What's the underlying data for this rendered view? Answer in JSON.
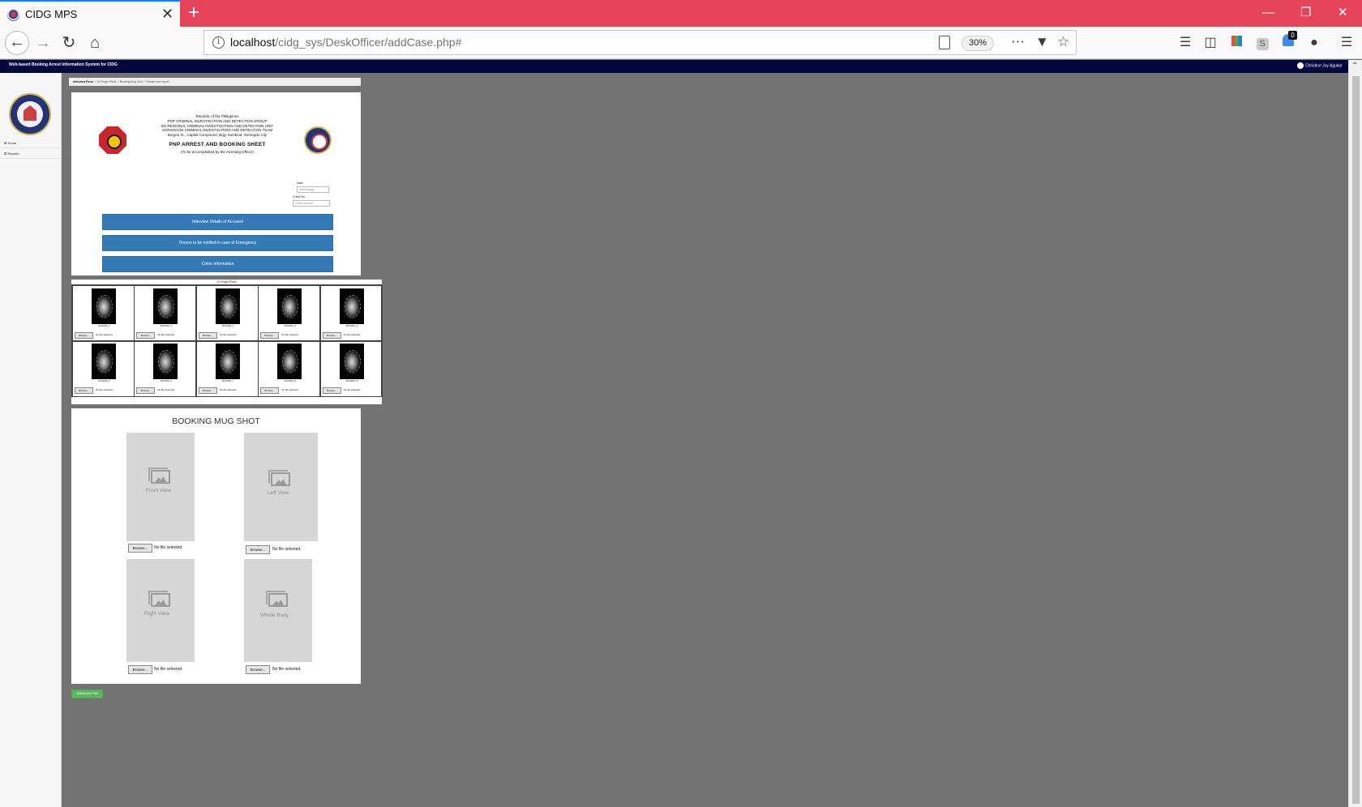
{
  "browser": {
    "tab_title": "CIDG MPS",
    "tab_close": "✕",
    "new_tab": "+",
    "url_host": "localhost",
    "url_path": "/cidg_sys/DeskOfficer/addCase.php#",
    "zoom": "30%",
    "notification_count": "0",
    "accent_color": "#e5445a"
  },
  "site": {
    "title": "Web-based Booking Arrest Information System for CIDG",
    "user": "Christine Joy Aguilar",
    "header_color": "#02063d"
  },
  "sidebar": {
    "items": [
      {
        "label": "⊞ Home"
      },
      {
        "label": "⊞ Reports"
      }
    ]
  },
  "breadcrumb": {
    "items": [
      "Interview Form",
      "10 Finger Prints",
      "Booking Mug Shot",
      "Create new report"
    ]
  },
  "form": {
    "header_lines": [
      "Republic of the Philippines",
      "PNP CRIMINAL INVESTIGATION AND DETECTION GROUP",
      "5th REGIONAL CRIMINAL INVESTIGATION AND DETECTION UNIT",
      "SORSOGON CRIMINAL INVESTIGATION AND DETECTION TEAM",
      "Burgos St., Capitol Compound, Brgy Sumbiod, Sorsogon City"
    ],
    "title": "PNP ARREST AND BOOKING SHEET",
    "subtitle": "(To be accomplished by the Arresting Officer)",
    "date_label": "Date:",
    "date_value": "dd/mm/yyyy",
    "crime_no_label": "Crime No.",
    "crime_no_placeholder": "Crime number",
    "buttons": [
      "Interview Details of Accused",
      "Person to be notified in case of Emergency",
      "Crime Information"
    ]
  },
  "fingerprints": {
    "title": "10 Finger Prints",
    "browse_label": "Browse...",
    "no_file": "No file selected.",
    "labels": [
      "RUGPR_1",
      "RUGPR_1",
      "RUGPR_2",
      "RUGPR_3",
      "RUGPR_4",
      "RUGPR_5",
      "RUGPR_6",
      "RUGPR_7",
      "RUGPR_8",
      "RUGPR_9"
    ]
  },
  "mugshot": {
    "title": "BOOKING MUG SHOT",
    "browse_label": "Browse...",
    "no_file": "No file selected.",
    "views": [
      "Front View",
      "Left  View",
      "Right View",
      "Whole Body"
    ]
  },
  "submit_label": "Submit and Print"
}
